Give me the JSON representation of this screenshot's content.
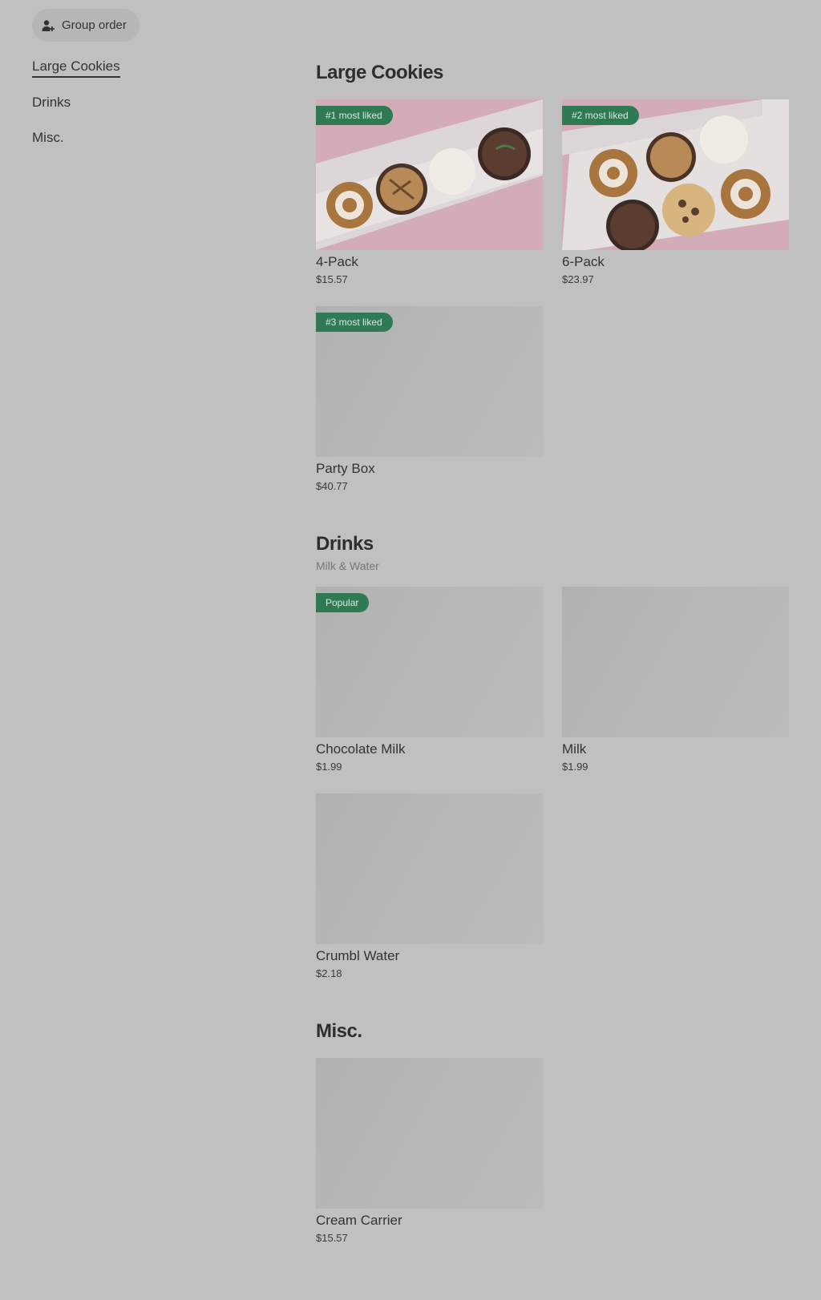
{
  "header": {
    "group_order_label": "Group order",
    "group_order_icon": "person-add-icon"
  },
  "sidebar": {
    "items": [
      {
        "label": "Large Cookies",
        "active": true
      },
      {
        "label": "Drinks",
        "active": false
      },
      {
        "label": "Misc.",
        "active": false
      }
    ]
  },
  "sections": [
    {
      "title": "Large Cookies",
      "subtitle": "",
      "items": [
        {
          "name": "4-Pack",
          "price": "$15.57",
          "badge": "#1 most liked",
          "image": "cookies-4-pack-photo"
        },
        {
          "name": "6-Pack",
          "price": "$23.97",
          "badge": "#2 most liked",
          "image": "cookies-6-pack-photo"
        },
        {
          "name": "Party Box",
          "price": "$40.77",
          "badge": "#3 most liked",
          "image": "placeholder"
        }
      ]
    },
    {
      "title": "Drinks",
      "subtitle": "Milk & Water",
      "items": [
        {
          "name": "Chocolate Milk",
          "price": "$1.99",
          "badge": "Popular",
          "image": "placeholder"
        },
        {
          "name": "Milk",
          "price": "$1.99",
          "badge": "",
          "image": "placeholder"
        },
        {
          "name": "Crumbl Water",
          "price": "$2.18",
          "badge": "",
          "image": "placeholder"
        }
      ]
    },
    {
      "title": "Misc.",
      "subtitle": "",
      "items": [
        {
          "name": "Cream Carrier",
          "price": "$15.57",
          "badge": "",
          "image": "placeholder"
        }
      ]
    }
  ],
  "colors": {
    "overlay_background": "#c0c0c0",
    "badge_background": "#2f7a55",
    "image_pink": "#c9a6b0"
  }
}
